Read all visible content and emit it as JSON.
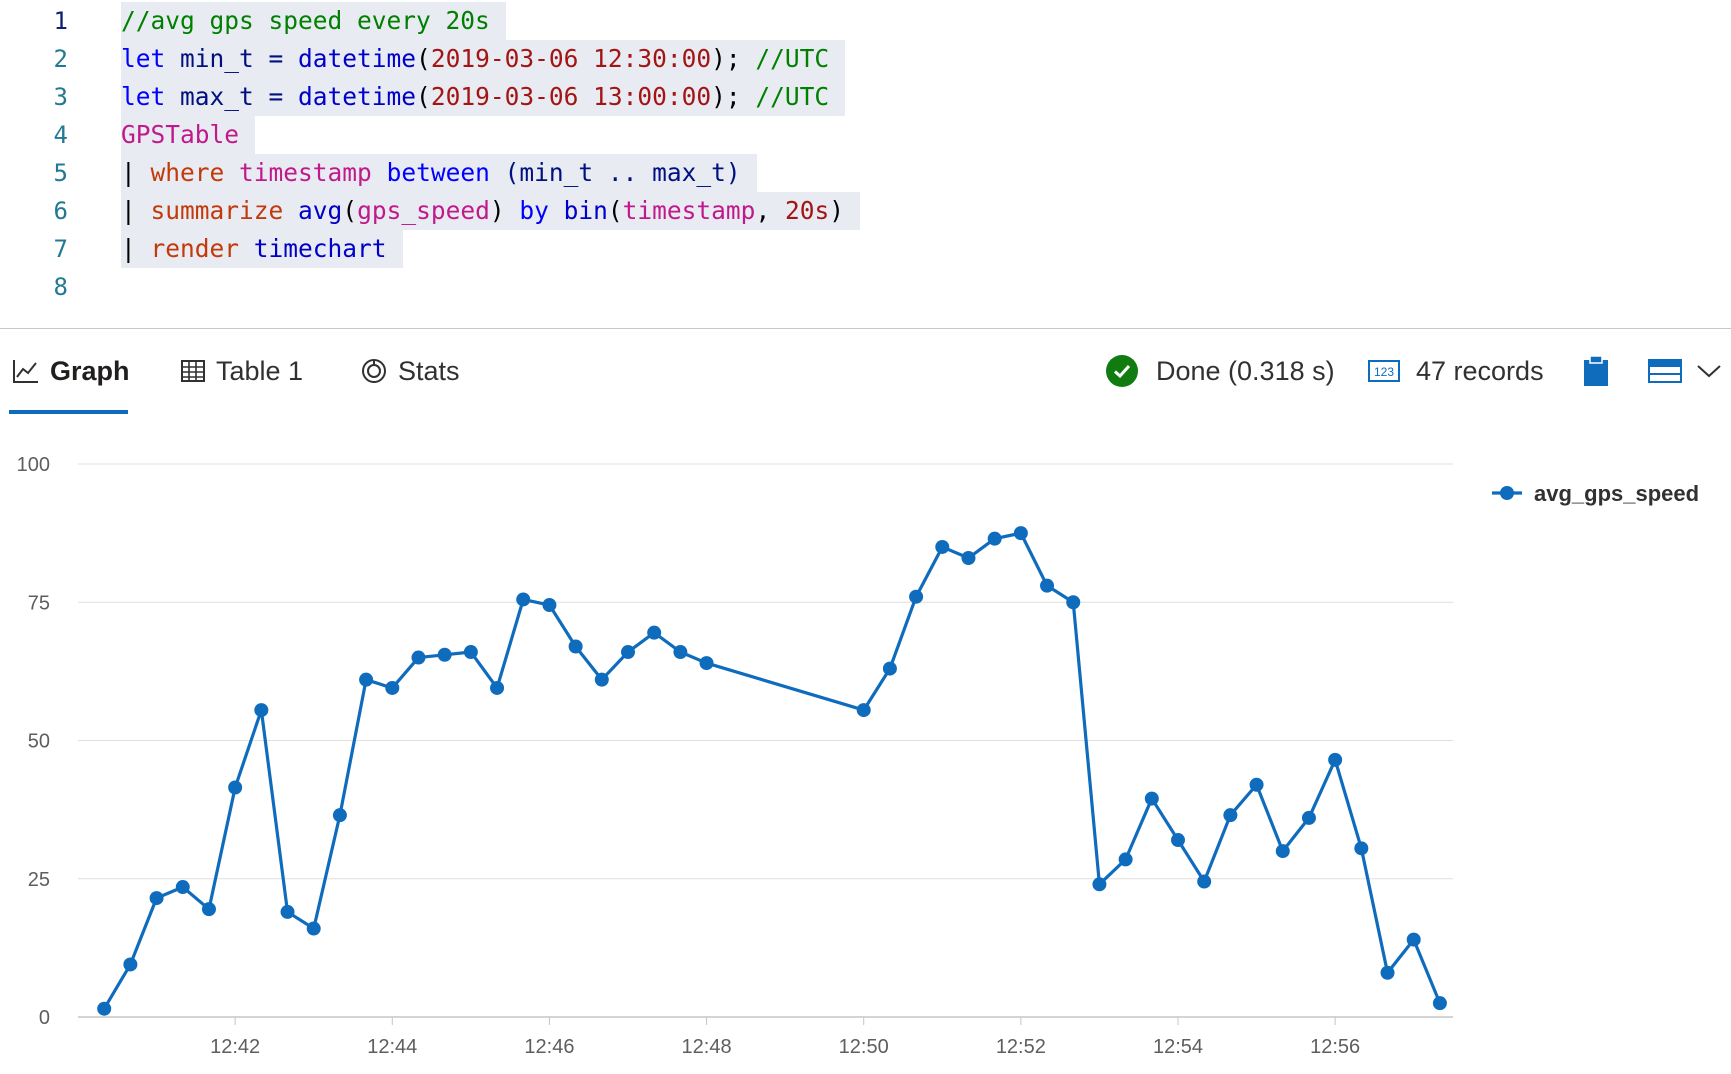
{
  "editor": {
    "lines": [
      {
        "num": "1",
        "tokens": [
          {
            "t": "//avg gps speed every 20s",
            "c": "t-comment"
          }
        ]
      },
      {
        "num": "2",
        "tokens": [
          {
            "t": "let",
            "c": "t-kw"
          },
          {
            "t": " min_t = ",
            "c": "t-ident"
          },
          {
            "t": "datetime",
            "c": "t-func"
          },
          {
            "t": "(",
            "c": "t-plain"
          },
          {
            "t": "2019-03-06 12:30:00",
            "c": "t-str"
          },
          {
            "t": "); ",
            "c": "t-plain"
          },
          {
            "t": "//UTC",
            "c": "t-comment"
          }
        ]
      },
      {
        "num": "3",
        "tokens": [
          {
            "t": "let",
            "c": "t-kw"
          },
          {
            "t": " max_t = ",
            "c": "t-ident"
          },
          {
            "t": "datetime",
            "c": "t-func"
          },
          {
            "t": "(",
            "c": "t-plain"
          },
          {
            "t": "2019-03-06 13:00:00",
            "c": "t-str"
          },
          {
            "t": "); ",
            "c": "t-plain"
          },
          {
            "t": "//UTC",
            "c": "t-comment"
          }
        ]
      },
      {
        "num": "4",
        "tokens": [
          {
            "t": "GPSTable",
            "c": "t-table"
          }
        ]
      },
      {
        "num": "5",
        "tokens": [
          {
            "t": "| ",
            "c": "t-plain"
          },
          {
            "t": "where",
            "c": "t-op"
          },
          {
            "t": " ",
            "c": "t-plain"
          },
          {
            "t": "timestamp",
            "c": "t-col"
          },
          {
            "t": " between ",
            "c": "t-kw"
          },
          {
            "t": "(min_t .. max_t)",
            "c": "t-ident"
          }
        ]
      },
      {
        "num": "6",
        "tokens": [
          {
            "t": "| ",
            "c": "t-plain"
          },
          {
            "t": "summarize",
            "c": "t-op"
          },
          {
            "t": " ",
            "c": "t-plain"
          },
          {
            "t": "avg",
            "c": "t-func"
          },
          {
            "t": "(",
            "c": "t-plain"
          },
          {
            "t": "gps_speed",
            "c": "t-col"
          },
          {
            "t": ") ",
            "c": "t-plain"
          },
          {
            "t": "by",
            "c": "t-kw"
          },
          {
            "t": " ",
            "c": "t-plain"
          },
          {
            "t": "bin",
            "c": "t-func"
          },
          {
            "t": "(",
            "c": "t-plain"
          },
          {
            "t": "timestamp",
            "c": "t-col"
          },
          {
            "t": ", ",
            "c": "t-plain"
          },
          {
            "t": "20s",
            "c": "t-num"
          },
          {
            "t": ")",
            "c": "t-plain"
          }
        ]
      },
      {
        "num": "7",
        "tokens": [
          {
            "t": "| ",
            "c": "t-plain"
          },
          {
            "t": "render",
            "c": "t-op"
          },
          {
            "t": " ",
            "c": "t-plain"
          },
          {
            "t": "timechart",
            "c": "t-func"
          }
        ]
      },
      {
        "num": "8",
        "tokens": []
      }
    ]
  },
  "results": {
    "tabs": [
      {
        "label": "Graph",
        "icon": "line-chart-icon",
        "active": true
      },
      {
        "label": "Table 1",
        "icon": "table-grid-icon",
        "active": false
      },
      {
        "label": "Stats",
        "icon": "stats-circle-icon",
        "active": false
      }
    ],
    "status_text": "Done (0.318 s)",
    "records_text": "47 records",
    "status_color": "#107c10",
    "accent": "#0f6cbd"
  },
  "chart_data": {
    "type": "line",
    "x_unit": "time (HH:MM:SS)",
    "x": [
      "12:40:20",
      "12:40:40",
      "12:41:00",
      "12:41:20",
      "12:41:40",
      "12:42:00",
      "12:42:20",
      "12:42:40",
      "12:43:00",
      "12:43:20",
      "12:43:40",
      "12:44:00",
      "12:44:20",
      "12:44:40",
      "12:45:00",
      "12:45:20",
      "12:45:40",
      "12:46:00",
      "12:46:20",
      "12:46:40",
      "12:47:00",
      "12:47:20",
      "12:47:40",
      "12:48:00",
      "12:50:00",
      "12:50:20",
      "12:50:40",
      "12:51:00",
      "12:51:20",
      "12:51:40",
      "12:52:00",
      "12:52:20",
      "12:52:40",
      "12:53:00",
      "12:53:20",
      "12:53:40",
      "12:54:00",
      "12:54:20",
      "12:54:40",
      "12:55:00",
      "12:55:20",
      "12:55:40",
      "12:56:00",
      "12:56:20",
      "12:56:40",
      "12:57:00",
      "12:57:20"
    ],
    "series": [
      {
        "name": "avg_gps_speed",
        "color": "#0f6cbd",
        "values": [
          1.5,
          9.5,
          21.5,
          23.5,
          19.5,
          41.5,
          55.5,
          19,
          16,
          36.5,
          61,
          59.5,
          65,
          65.5,
          66,
          59.5,
          75.5,
          74.5,
          67,
          61,
          66,
          69.5,
          66,
          64,
          55.5,
          63,
          76,
          85,
          83,
          86.5,
          87.5,
          78,
          75,
          24,
          28.5,
          39.5,
          32,
          24.5,
          36.5,
          42,
          30,
          36,
          46.5,
          30.5,
          8,
          14,
          2.5
        ]
      }
    ],
    "x_ticks": [
      "12:42",
      "12:44",
      "12:46",
      "12:48",
      "12:50",
      "12:52",
      "12:54",
      "12:56"
    ],
    "y_ticks": [
      "0",
      "25",
      "50",
      "75",
      "100"
    ],
    "ylim": [
      0,
      100
    ],
    "grid": true,
    "legend_position": "top-right"
  }
}
